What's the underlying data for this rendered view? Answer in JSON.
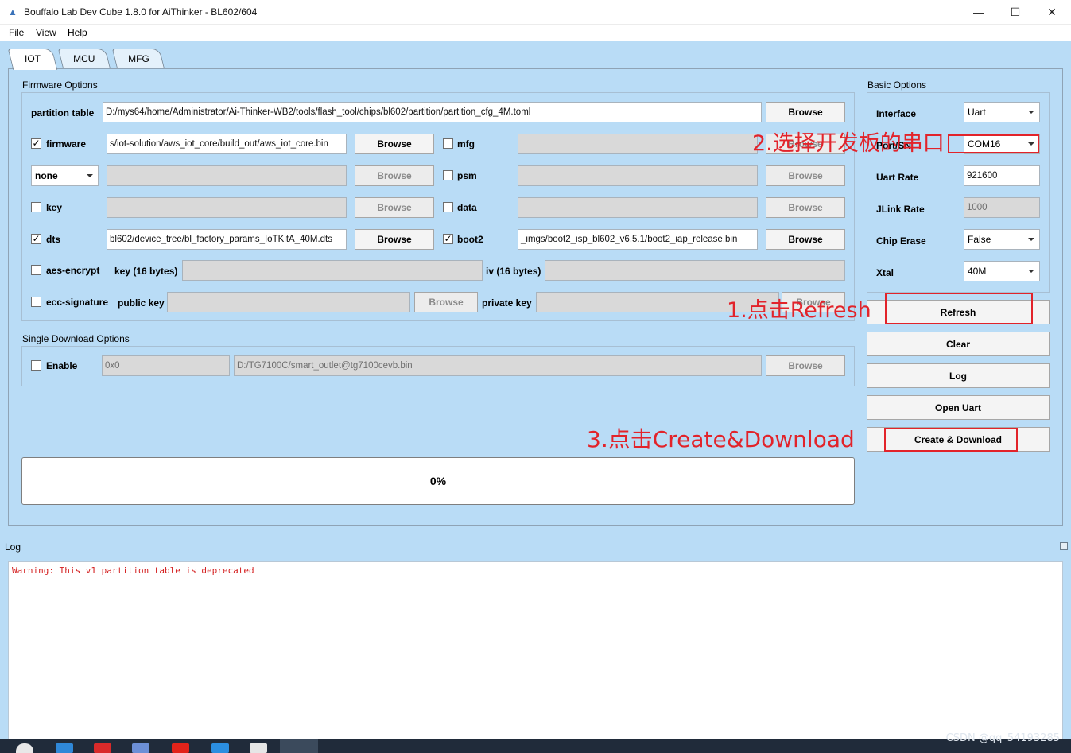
{
  "window": {
    "title": "Bouffalo Lab Dev Cube 1.8.0 for AiThinker - BL602/604",
    "app_icon": "cube-icon",
    "minimize_glyph": "—",
    "maximize_glyph": "☐",
    "close_glyph": "✕"
  },
  "menu": [
    "File",
    "View",
    "Help"
  ],
  "tabs": [
    "IOT",
    "MCU",
    "MFG"
  ],
  "firmware_options": {
    "title": "Firmware Options",
    "partition_table": {
      "label": "partition table",
      "value": "D:/mys64/home/Administrator/Ai-Thinker-WB2/tools/flash_tool/chips/bl602/partition/partition_cfg_4M.toml",
      "button": "Browse"
    },
    "firmware": {
      "label": "firmware",
      "checked": "✓",
      "value": "s/iot-solution/aws_iot_core/build_out/aws_iot_core.bin",
      "button": "Browse"
    },
    "mfg": {
      "label": "mfg",
      "value": "",
      "button": "Browse"
    },
    "none_select": {
      "value": "none",
      "value_field": "",
      "button": "Browse"
    },
    "psm": {
      "label": "psm",
      "value": "",
      "button": "Browse"
    },
    "key": {
      "label": "key",
      "value": "",
      "button": "Browse"
    },
    "data": {
      "label": "data",
      "value": "",
      "button": "Browse"
    },
    "dts": {
      "label": "dts",
      "checked": "✓",
      "value": "bl602/device_tree/bl_factory_params_IoTKitA_40M.dts",
      "button": "Browse"
    },
    "boot2": {
      "label": "boot2",
      "checked": "✓",
      "value": "_imgs/boot2_isp_bl602_v6.5.1/boot2_iap_release.bin",
      "button": "Browse"
    },
    "aes_encrypt": {
      "label": "aes-encrypt",
      "key_label": "key (16 bytes)",
      "iv_label": "iv (16 bytes)",
      "key_value": "",
      "iv_value": ""
    },
    "ecc_signature": {
      "label": "ecc-signature",
      "public_key_label": "public key",
      "private_key_label": "private key",
      "public_value": "",
      "private_value": "",
      "button": "Browse",
      "button2": "Browse"
    }
  },
  "single_download": {
    "title": "Single Download Options",
    "enable_label": "Enable",
    "address": "0x0",
    "path": "D:/TG7100C/smart_outlet@tg7100cevb.bin",
    "button": "Browse"
  },
  "basic_options": {
    "title": "Basic Options",
    "interface": {
      "label": "Interface",
      "value": "Uart"
    },
    "port": {
      "label": "Port/SN",
      "value": "COM16"
    },
    "uart_rate": {
      "label": "Uart Rate",
      "value": "921600"
    },
    "jlink_rate": {
      "label": "JLink Rate",
      "value": "1000"
    },
    "chip_erase": {
      "label": "Chip Erase",
      "value": "False"
    },
    "xtal": {
      "label": "Xtal",
      "value": "40M"
    }
  },
  "actions": {
    "refresh": "Refresh",
    "clear": "Clear",
    "log": "Log",
    "open_uart": "Open Uart",
    "create_download": "Create & Download"
  },
  "progress": {
    "percent": 0,
    "text": "0%"
  },
  "annotations": {
    "step1": "1.点击Refresh",
    "step2": "2.选择开发板的串口",
    "step3": "3.点击Create&Download",
    "color": "#e2232a"
  },
  "log": {
    "label": "Log",
    "text": "Warning: This v1 partition table is deprecated"
  },
  "watermark": "CSDN @qq_54193285",
  "taskbar_icons": [
    "start-icon",
    "media-icon",
    "app-red-icon",
    "app-blue-icon",
    "app-tianmao-icon",
    "vscode-icon",
    "notepad-icon",
    "devcube-icon"
  ]
}
